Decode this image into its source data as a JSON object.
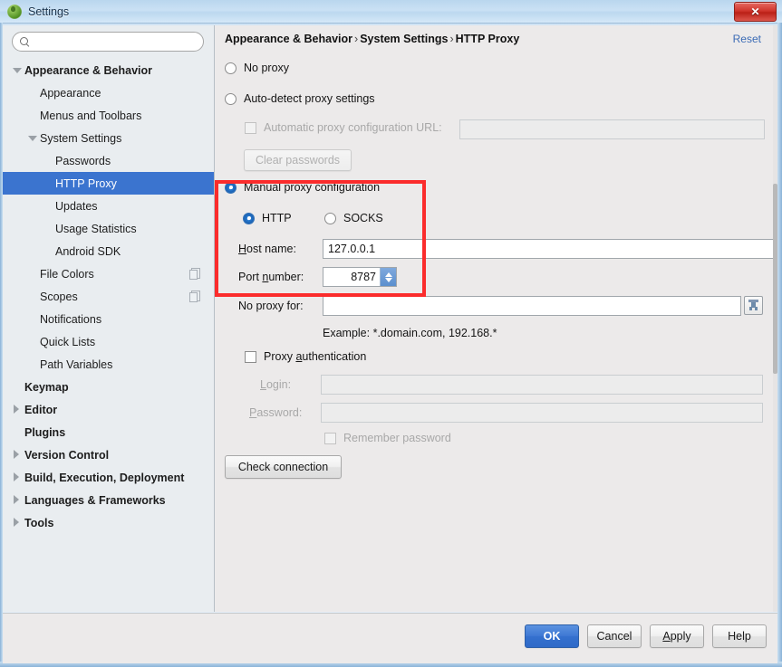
{
  "window": {
    "title": "Settings",
    "icon": "android-studio-icon",
    "close_label": "✕"
  },
  "sidebar": {
    "search": {
      "value": "",
      "placeholder": ""
    },
    "items": [
      {
        "label": "Appearance & Behavior",
        "indent": 0,
        "twisty": "down",
        "bold": true,
        "selected": false,
        "icon": false
      },
      {
        "label": "Appearance",
        "indent": 1,
        "twisty": "none",
        "bold": false,
        "selected": false,
        "icon": false
      },
      {
        "label": "Menus and Toolbars",
        "indent": 1,
        "twisty": "none",
        "bold": false,
        "selected": false,
        "icon": false
      },
      {
        "label": "System Settings",
        "indent": 1,
        "twisty": "down",
        "bold": false,
        "selected": false,
        "icon": false
      },
      {
        "label": "Passwords",
        "indent": 2,
        "twisty": "none",
        "bold": false,
        "selected": false,
        "icon": false
      },
      {
        "label": "HTTP Proxy",
        "indent": 2,
        "twisty": "none",
        "bold": false,
        "selected": true,
        "icon": false
      },
      {
        "label": "Updates",
        "indent": 2,
        "twisty": "none",
        "bold": false,
        "selected": false,
        "icon": false
      },
      {
        "label": "Usage Statistics",
        "indent": 2,
        "twisty": "none",
        "bold": false,
        "selected": false,
        "icon": false
      },
      {
        "label": "Android SDK",
        "indent": 2,
        "twisty": "none",
        "bold": false,
        "selected": false,
        "icon": false
      },
      {
        "label": "File Colors",
        "indent": 1,
        "twisty": "none",
        "bold": false,
        "selected": false,
        "icon": true
      },
      {
        "label": "Scopes",
        "indent": 1,
        "twisty": "none",
        "bold": false,
        "selected": false,
        "icon": true
      },
      {
        "label": "Notifications",
        "indent": 1,
        "twisty": "none",
        "bold": false,
        "selected": false,
        "icon": false
      },
      {
        "label": "Quick Lists",
        "indent": 1,
        "twisty": "none",
        "bold": false,
        "selected": false,
        "icon": false
      },
      {
        "label": "Path Variables",
        "indent": 1,
        "twisty": "none",
        "bold": false,
        "selected": false,
        "icon": false
      },
      {
        "label": "Keymap",
        "indent": 0,
        "twisty": "none",
        "bold": true,
        "selected": false,
        "icon": false
      },
      {
        "label": "Editor",
        "indent": 0,
        "twisty": "right",
        "bold": true,
        "selected": false,
        "icon": false
      },
      {
        "label": "Plugins",
        "indent": 0,
        "twisty": "none",
        "bold": true,
        "selected": false,
        "icon": false
      },
      {
        "label": "Version Control",
        "indent": 0,
        "twisty": "right",
        "bold": true,
        "selected": false,
        "icon": false
      },
      {
        "label": "Build, Execution, Deployment",
        "indent": 0,
        "twisty": "right",
        "bold": true,
        "selected": false,
        "icon": false
      },
      {
        "label": "Languages & Frameworks",
        "indent": 0,
        "twisty": "right",
        "bold": true,
        "selected": false,
        "icon": false
      },
      {
        "label": "Tools",
        "indent": 0,
        "twisty": "right",
        "bold": true,
        "selected": false,
        "icon": false
      }
    ]
  },
  "main": {
    "breadcrumb": {
      "part1": "Appearance & Behavior",
      "sep1": "›",
      "part2": "System Settings",
      "sep2": "›",
      "part3": "HTTP Proxy"
    },
    "reset_label": "Reset",
    "no_proxy_label": "No proxy",
    "auto_detect_label": "Auto-detect proxy settings",
    "auto_config_url_label": "Automatic proxy configuration URL:",
    "auto_config_url_value": "",
    "clear_passwords_label": "Clear passwords",
    "manual_label": "Manual proxy configuration",
    "http_label": "HTTP",
    "socks_label": "SOCKS",
    "host_name_label": "Host name:",
    "host_name_value": "127.0.0.1",
    "port_number_label": "Port number:",
    "port_number_value": "8787",
    "no_proxy_for_label": "No proxy for:",
    "no_proxy_for_value": "",
    "example_text": "Example: *.domain.com, 192.168.*",
    "proxy_auth_label": "Proxy authentication",
    "login_label": "Login:",
    "login_value": "",
    "password_label": "Password:",
    "password_value": "",
    "remember_password_label": "Remember password",
    "check_connection_label": "Check connection",
    "browse_icon": "import-list-icon",
    "selection": {
      "no_proxy": false,
      "auto_detect": false,
      "manual": true,
      "protocol": "HTTP",
      "auto_config_url_checked": false,
      "proxy_auth_checked": false,
      "remember_password_checked": false
    }
  },
  "footer": {
    "ok_label": "OK",
    "cancel_label": "Cancel",
    "apply_label": "Apply",
    "help_label": "Help"
  },
  "colors": {
    "selection_blue": "#3b74cf",
    "highlight_red": "#fb2c2c",
    "link_blue": "#3b6bb5",
    "ok_blue": "#3f79d4"
  }
}
